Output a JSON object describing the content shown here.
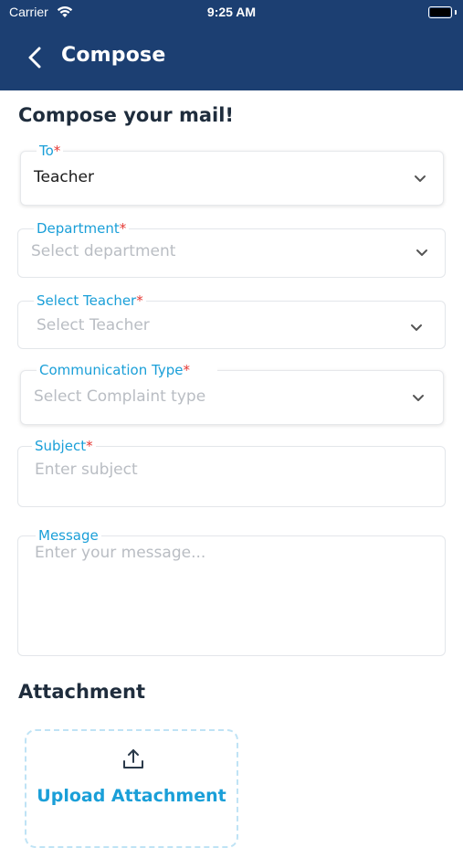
{
  "status_bar": {
    "carrier": "Carrier",
    "time": "9:25 AM"
  },
  "nav": {
    "title": "Compose",
    "back_icon": "chevron-left-icon"
  },
  "form": {
    "heading": "Compose your mail!",
    "to": {
      "label": "To",
      "required": "*",
      "value": "Teacher"
    },
    "department": {
      "label": "Department",
      "required": "*",
      "placeholder": "Select department"
    },
    "teacher": {
      "label": "Select Teacher",
      "required": "*",
      "placeholder": "Select Teacher"
    },
    "communication_type": {
      "label": "Communication Type",
      "required": "*",
      "placeholder": "Select Complaint type"
    },
    "subject": {
      "label": "Subject",
      "required": "*",
      "placeholder": "Enter subject"
    },
    "message": {
      "label": "Message",
      "placeholder": "Enter your message..."
    }
  },
  "attachment": {
    "title": "Attachment",
    "upload_label": "Upload Attachment",
    "upload_icon": "upload-icon"
  },
  "colors": {
    "header_bg": "#1c3f72",
    "label": "#1a9fd8",
    "required": "#e53935",
    "placeholder": "#b9bdc3",
    "heading": "#1f2d3d"
  }
}
